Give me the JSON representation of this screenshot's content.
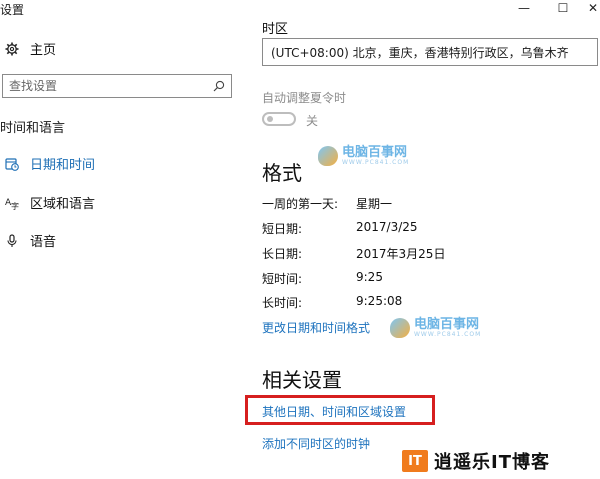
{
  "window": {
    "title": "设置",
    "minimize_glyph": "—",
    "maximize_glyph": "☐",
    "close_glyph": "✕"
  },
  "sidebar": {
    "home": {
      "icon": "gear-icon",
      "label": "主页"
    },
    "search": {
      "placeholder": "查找设置",
      "icon": "search-icon"
    },
    "section_title": "时间和语言",
    "items": [
      {
        "icon": "clock-calendar-icon",
        "label": "日期和时间",
        "selected": true
      },
      {
        "icon": "language-icon",
        "label": "区域和语言",
        "selected": false
      },
      {
        "icon": "microphone-icon",
        "label": "语音",
        "selected": false
      }
    ]
  },
  "main": {
    "timezone": {
      "label": "时区",
      "value": "(UTC+08:00) 北京，重庆，香港特别行政区，乌鲁木齐"
    },
    "dst": {
      "label": "自动调整夏令时",
      "state_label": "关",
      "on": false
    },
    "format": {
      "heading": "格式",
      "rows": [
        {
          "key": "一周的第一天:",
          "value": "星期一"
        },
        {
          "key": "短日期:",
          "value": "2017/3/25"
        },
        {
          "key": "长日期:",
          "value": "2017年3月25日"
        },
        {
          "key": "短时间:",
          "value": "9:25"
        },
        {
          "key": "长时间:",
          "value": "9:25:08"
        }
      ],
      "change_link": "更改日期和时间格式"
    },
    "related": {
      "heading": "相关设置",
      "links": [
        "其他日期、时间和区域设置",
        "添加不同时区的时钟"
      ]
    }
  },
  "watermarks": {
    "site_name": "电脑百事网",
    "site_url": "WWW.PC841.COM",
    "brand_tag": "IT",
    "brand_text": "逍遥乐IT博客"
  },
  "colors": {
    "accent": "#1e6fb5",
    "link": "#1e73be",
    "highlight_box": "#d61f1f",
    "brand_orange": "#f07b1d"
  }
}
